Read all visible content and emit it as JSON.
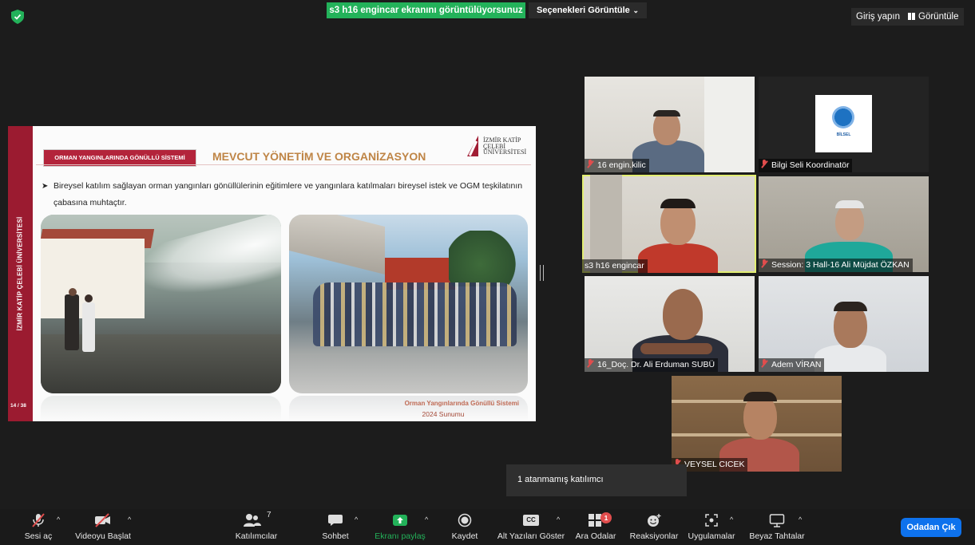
{
  "top_bar": {
    "share_banner": "s3 h16 engincar ekranını görüntülüyorsunuz",
    "view_options": "Seçenekleri Görüntüle",
    "sign_in": "Giriş yapın",
    "view": "Görüntüle",
    "shield_color": "#23b25a"
  },
  "slide": {
    "side_text": "İZMİR KATİP ÇELEBİ ÜNİVERSİTESİ",
    "page": "14 / 38",
    "tag": "ORMAN YANGINLARINDA GÖNÜLLÜ SİSTEMİ",
    "title": "MEVCUT YÖNETİM VE ORGANİZASYON",
    "logo_text": "İZMİR KATİP ÇELEBİ ÜNİVERSİTESİ",
    "bullet": "Bireysel katılım sağlayan orman yangınları gönüllülerinin eğitimlere ve yangınlara katılmaları bireysel istek ve  OGM teşkilatının çabasına muhtaçtır.",
    "footer_line1": "Orman Yangınlarında Gönüllü Sistemi",
    "footer_line2": "2024 Sunumu"
  },
  "participants": [
    {
      "name": "16 engin.kilic"
    },
    {
      "name": "Bilgi Seli Koordinatör",
      "logo_text": "BİLSEL"
    },
    {
      "name": "s3 h16 engincar"
    },
    {
      "name": "Session: 3 Hall-16 Ali Müjdat ÖZKAN"
    },
    {
      "name": "16_Doç. Dr. Ali Erduman SUBÜ"
    },
    {
      "name": "Adem VİRAN"
    },
    {
      "name": "VEYSEL CICEK"
    }
  ],
  "tooltip": "1 atanmamış katılımcı",
  "toolbar": {
    "audio": "Sesi aç",
    "video": "Videoyu Başlat",
    "participants": "Katılımcılar",
    "participants_count": "7",
    "chat": "Sohbet",
    "share": "Ekranı paylaş",
    "record": "Kaydet",
    "captions": "Alt Yazıları Göster",
    "captions_icon_text": "CC",
    "breakout": "Ara Odalar",
    "breakout_badge": "1",
    "reactions": "Reaksiyonlar",
    "apps": "Uygulamalar",
    "whiteboards": "Beyaz Tahtalar",
    "leave": "Odadan Çık",
    "accent": "#0e72ed",
    "share_color": "#23b25a"
  }
}
